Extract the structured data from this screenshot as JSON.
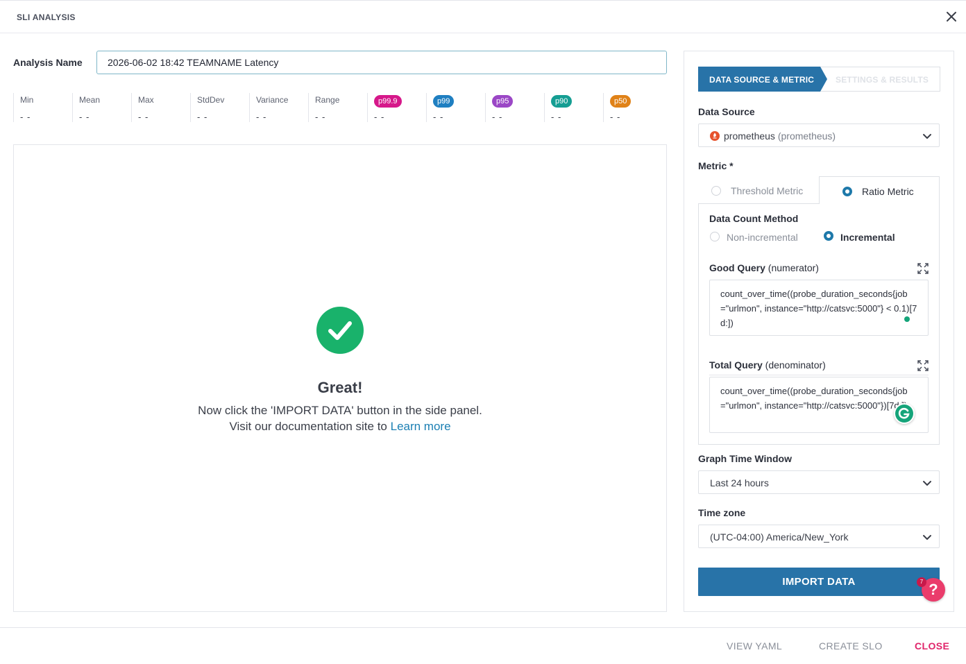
{
  "header": {
    "title": "SLI ANALYSIS",
    "close_icon": "close-icon"
  },
  "analysis": {
    "label": "Analysis Name",
    "value": "2026-06-02 18:42 TEAMNAME Latency"
  },
  "stats": [
    {
      "label": "Min",
      "value": "- -"
    },
    {
      "label": "Mean",
      "value": "- -"
    },
    {
      "label": "Max",
      "value": "- -"
    },
    {
      "label": "StdDev",
      "value": "- -"
    },
    {
      "label": "Variance",
      "value": "- -"
    },
    {
      "label": "Range",
      "value": "- -"
    },
    {
      "label": "p99.9",
      "value": "- -",
      "color": "#d6188a"
    },
    {
      "label": "p99",
      "value": "- -",
      "color": "#1f7fc1"
    },
    {
      "label": "p95",
      "value": "- -",
      "color": "#9b47c6"
    },
    {
      "label": "p90",
      "value": "- -",
      "color": "#159e93"
    },
    {
      "label": "p50",
      "value": "- -",
      "color": "#e08218"
    }
  ],
  "empty_state": {
    "title": "Great!",
    "line1": "Now click the 'IMPORT DATA' button in the side panel.",
    "line2_prefix": "Visit our documentation site to ",
    "link": "Learn more",
    "icon": "check-circle-icon"
  },
  "side": {
    "steps": {
      "active": "DATA SOURCE & METRIC",
      "inactive": "SETTINGS & RESULTS"
    },
    "data_source": {
      "label": "Data Source",
      "name": "prometheus",
      "type": "(prometheus)"
    },
    "metric": {
      "label": "Metric *",
      "tabs": {
        "threshold": "Threshold Metric",
        "ratio": "Ratio Metric",
        "selected": "ratio"
      },
      "count_method": {
        "label": "Data Count Method",
        "non_incremental": "Non-incremental",
        "incremental": "Incremental",
        "selected": "incremental"
      },
      "good_query": {
        "label": "Good Query",
        "suffix": "(numerator)",
        "value": "count_over_time((probe_duration_seconds{job=\"urlmon\", instance=\"http://catsvc:5000\"} < 0.1)[7d:])"
      },
      "total_query": {
        "label": "Total Query",
        "suffix": "(denominator)",
        "value": "count_over_time((probe_duration_seconds{job=\"urlmon\", instance=\"http://catsvc:5000\"})[7d:])"
      }
    },
    "graph_window": {
      "label": "Graph Time Window",
      "value": "Last 24 hours"
    },
    "timezone": {
      "label": "Time zone",
      "value": "(UTC-04:00) America/New_York"
    },
    "import_button": "IMPORT DATA"
  },
  "help": {
    "symbol": "?",
    "count": "7"
  },
  "footer": {
    "view_yaml": "VIEW YAML",
    "create_slo": "CREATE SLO",
    "close": "CLOSE"
  },
  "colors": {
    "accent": "#2873a8",
    "close": "#e0246a",
    "success": "#19b26b"
  }
}
